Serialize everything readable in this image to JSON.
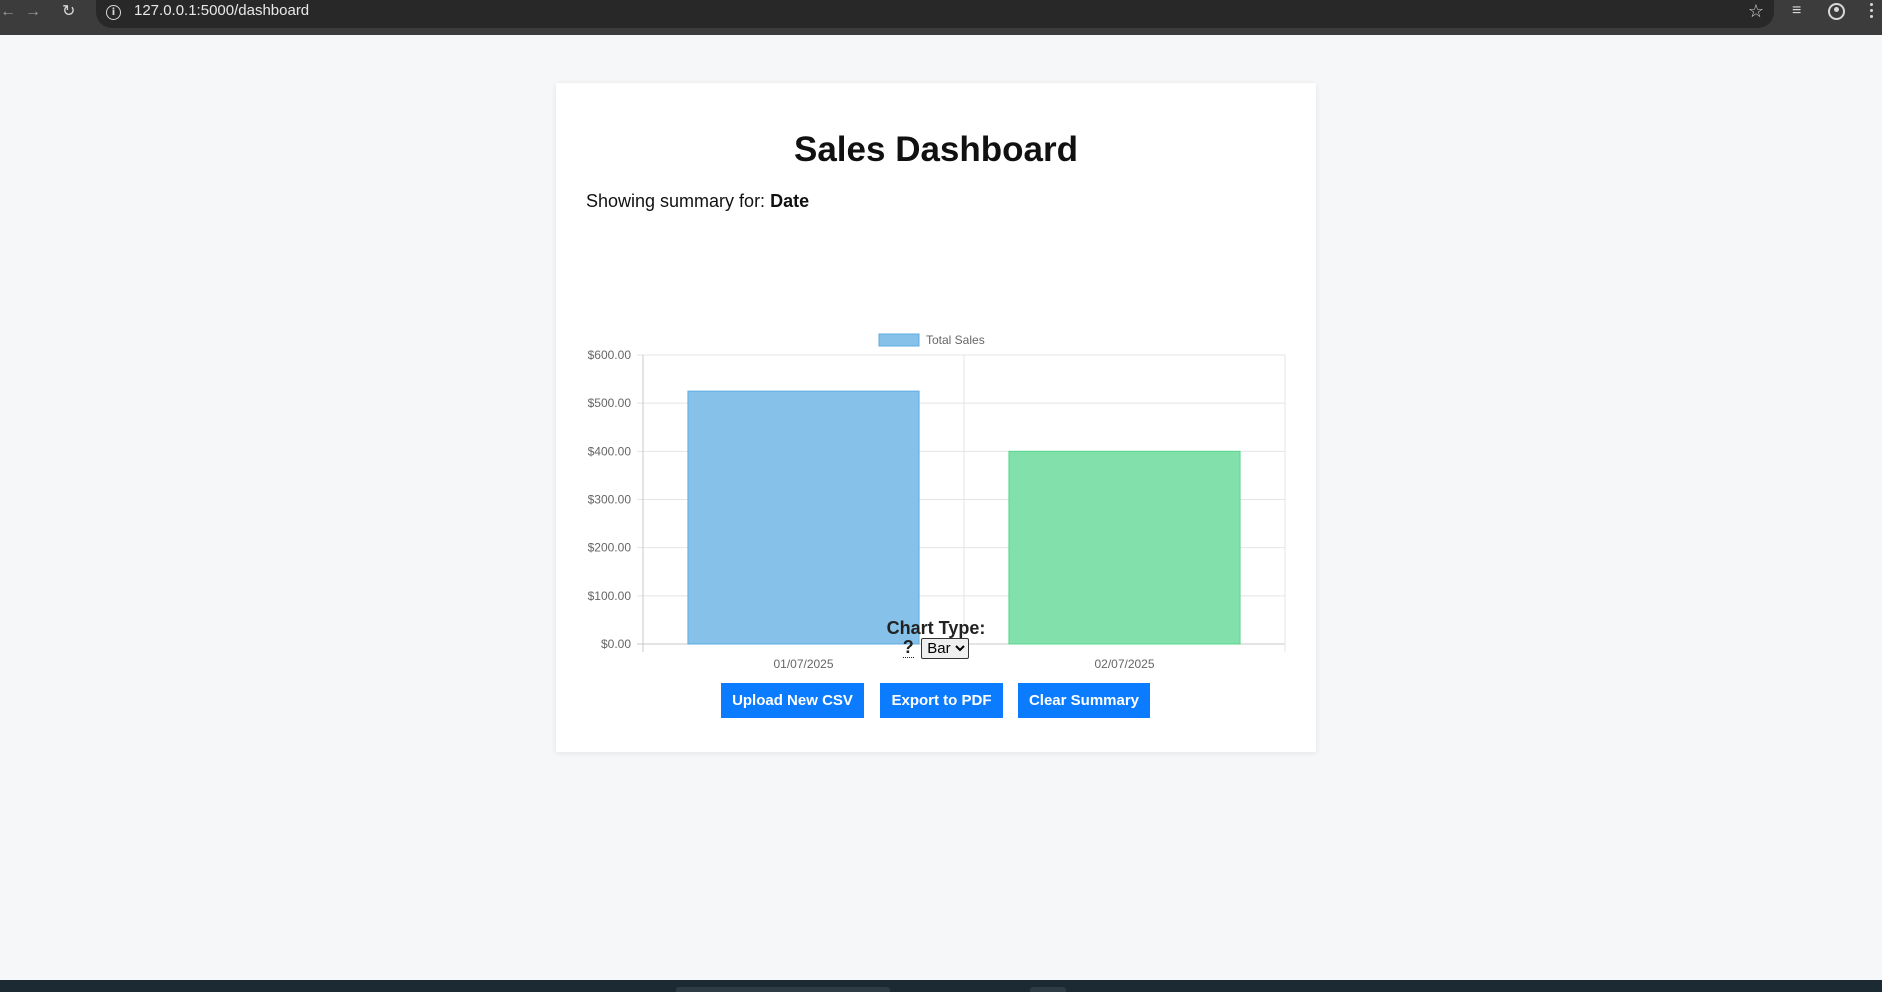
{
  "browser": {
    "url": "127.0.0.1:5000/dashboard"
  },
  "page": {
    "title": "Sales Dashboard",
    "summary_prefix": "Showing summary for:",
    "summary_field": "Date",
    "chart_type_label": "Chart Type:",
    "help_text": "?",
    "chart_type_selected": "Bar",
    "chart_type_options": [
      "Bar"
    ],
    "buttons": {
      "upload": "Upload New CSV",
      "export": "Export to PDF",
      "clear": "Clear Summary"
    }
  },
  "colors": {
    "accent": "#0b7cff",
    "bar_1": "#85c1e9",
    "bar_2": "#82e0aa"
  },
  "chart_data": {
    "type": "bar",
    "categories": [
      "01/07/2025",
      "02/07/2025"
    ],
    "series": [
      {
        "name": "Total Sales",
        "values": [
          525,
          400
        ]
      }
    ],
    "bar_colors": [
      "#85c1e9",
      "#82e0aa"
    ],
    "bar_border_colors": [
      "#5dade2",
      "#58d68d"
    ],
    "ylim": [
      0,
      600
    ],
    "yticks": [
      "$0.00",
      "$100.00",
      "$200.00",
      "$300.00",
      "$400.00",
      "$500.00",
      "$600.00"
    ],
    "ytick_values": [
      0,
      100,
      200,
      300,
      400,
      500,
      600
    ],
    "grid": true,
    "legend": "top-center"
  }
}
